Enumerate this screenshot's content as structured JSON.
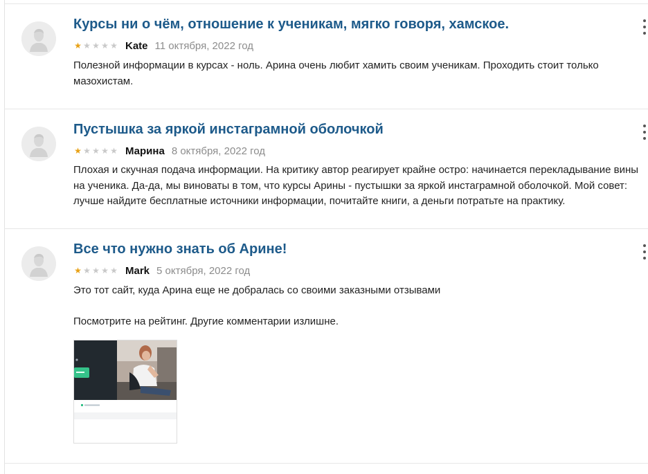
{
  "reviews": [
    {
      "title": "Курсы ни о чём, отношение к ученикам, мягко говоря, хамское.",
      "rating": 1,
      "max_rating": 5,
      "author": "Kate",
      "date": "11 октября, 2022 год",
      "text": [
        "Полезной информации в курсах - ноль. Арина очень любит хамить своим ученикам. Проходить стоит только мазохистам."
      ]
    },
    {
      "title": "Пустышка за яркой инстаграмной оболочкой",
      "rating": 1,
      "max_rating": 5,
      "author": "Марина",
      "date": "8 октября, 2022 год",
      "text": [
        "Плохая и скучная подача информации. На критику автор реагирует крайне остро: начинается перекладывание вины на ученика. Да-да, мы виноваты в том, что курсы Арины - пустышки за яркой инстаграмной оболочкой. Мой совет: лучше найдите бесплатные источники информации, почитайте книги, а деньги потратьте на практику."
      ]
    },
    {
      "title": "Все что нужно знать об Арине!",
      "rating": 1,
      "max_rating": 5,
      "author": "Mark",
      "date": "5 октября, 2022 год",
      "text": [
        "Это тот сайт, куда Арина еще не добралась со своими заказными отзывами",
        "Посмотрите на рейтинг. Другие комментарии излишне."
      ],
      "attachment": "screenshot-thumbnail"
    }
  ],
  "colors": {
    "title": "#1d5a8a",
    "star_on": "#e8a115",
    "star_off": "#c9c9c9",
    "date": "#8c8c8c"
  },
  "icons": {
    "avatar": "user-avatar-icon",
    "menu": "more-vertical-icon",
    "star": "star-icon"
  }
}
